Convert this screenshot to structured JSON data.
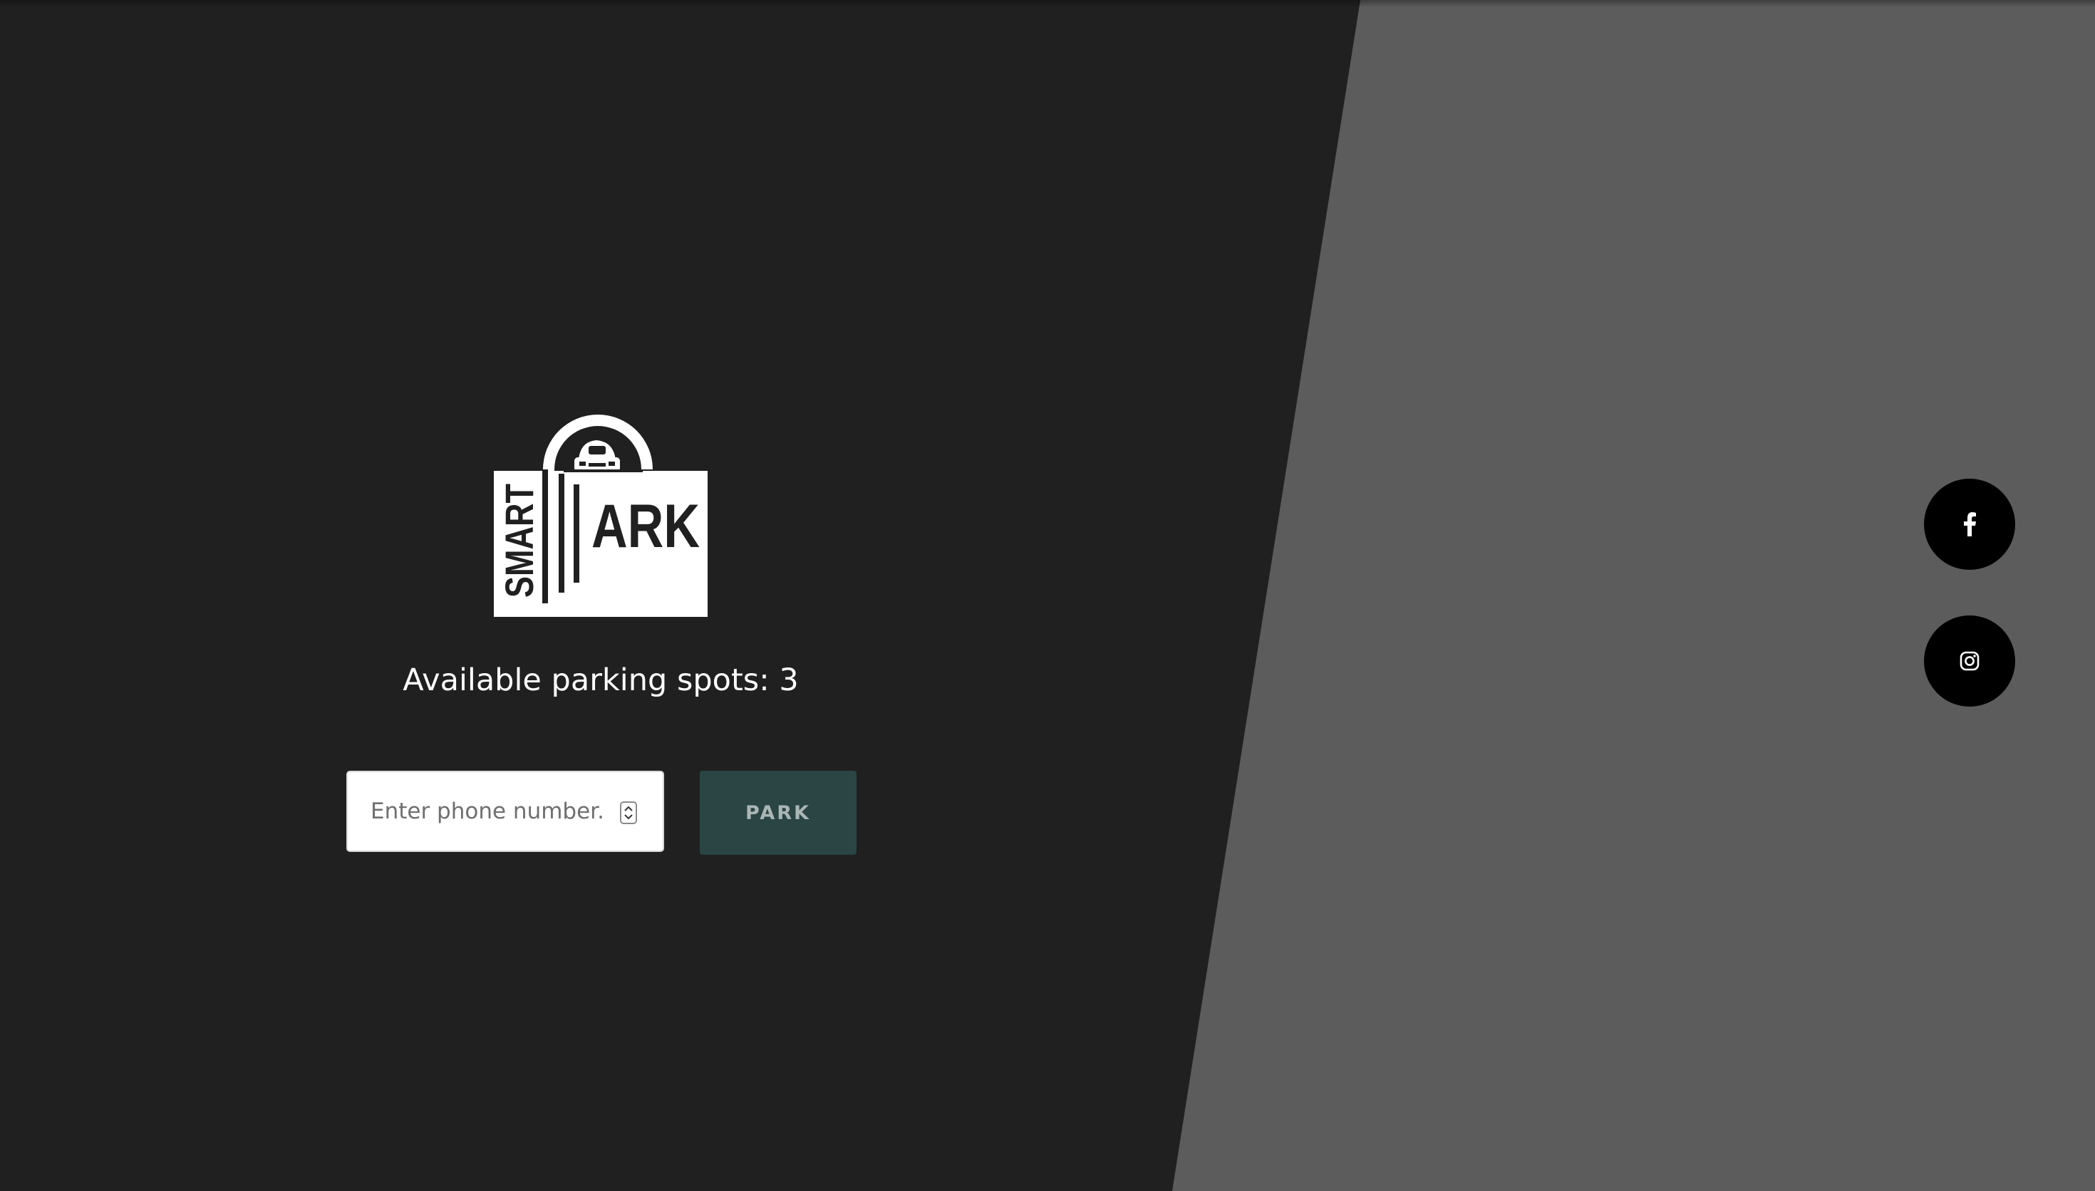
{
  "logo": {
    "left_text": "SMART",
    "right_text": "ARK"
  },
  "status": {
    "available_text": "Available parking spots: 3",
    "available_count": 3
  },
  "form": {
    "phone_placeholder": "Enter phone number...",
    "phone_value": "",
    "park_label": "PARK"
  },
  "social": [
    {
      "name": "facebook",
      "icon": "facebook-icon"
    },
    {
      "name": "instagram",
      "icon": "instagram-icon"
    }
  ],
  "colors": {
    "dark_background": "#202020",
    "light_background": "#5c5c5c",
    "button_background": "#2b4444",
    "button_text": "#aab6b6",
    "social_circle": "#000000"
  }
}
